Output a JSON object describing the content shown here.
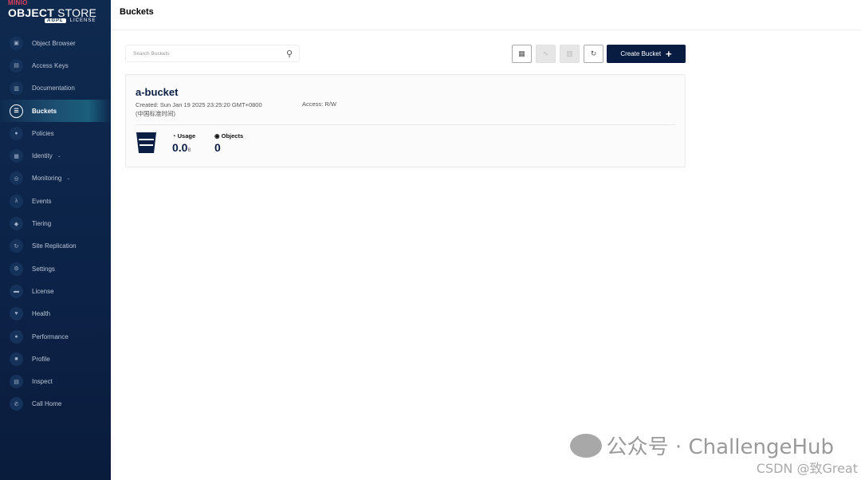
{
  "brand": {
    "mini": "MINIO",
    "object": "OBJECT",
    "store": "STORE",
    "badge": "AGPL",
    "license": "LICENSE"
  },
  "sidebar": {
    "items": [
      {
        "label": "Object Browser",
        "icon": "▣"
      },
      {
        "label": "Access Keys",
        "icon": "▤"
      },
      {
        "label": "Documentation",
        "icon": "▥"
      },
      {
        "label": "Buckets",
        "icon": "☰",
        "active": true
      },
      {
        "label": "Policies",
        "icon": "●"
      },
      {
        "label": "Identity",
        "icon": "▦",
        "chevron": "⌄"
      },
      {
        "label": "Monitoring",
        "icon": "◎",
        "chevron": "⌄"
      },
      {
        "label": "Events",
        "icon": "λ"
      },
      {
        "label": "Tiering",
        "icon": "◆"
      },
      {
        "label": "Site Replication",
        "icon": "↻"
      },
      {
        "label": "Settings",
        "icon": "⚙"
      },
      {
        "label": "License",
        "icon": "▬"
      },
      {
        "label": "Health",
        "icon": "♥"
      },
      {
        "label": "Performance",
        "icon": "●"
      },
      {
        "label": "Profile",
        "icon": "■"
      },
      {
        "label": "Inspect",
        "icon": "▤"
      },
      {
        "label": "Call Home",
        "icon": "✆"
      }
    ]
  },
  "header": {
    "title": "Buckets"
  },
  "toolbar": {
    "search_placeholder": "Search Buckets",
    "create_label": "Create Bucket"
  },
  "bucket": {
    "name": "a-bucket",
    "created": "Created: Sun Jan 19 2025 23:25:20 GMT+0800",
    "created_tz": "(中国标准时间)",
    "access": "Access: R/W",
    "usage_label": "Usage",
    "usage_value": "0.0",
    "usage_unit": "B",
    "objects_label": "Objects",
    "objects_value": "0"
  },
  "watermark": {
    "line1": "公众号 · ChallengeHub",
    "line2": "CSDN @致Great"
  },
  "colors": {
    "sidebar": "#0f2a4f",
    "primary": "#081c42"
  }
}
